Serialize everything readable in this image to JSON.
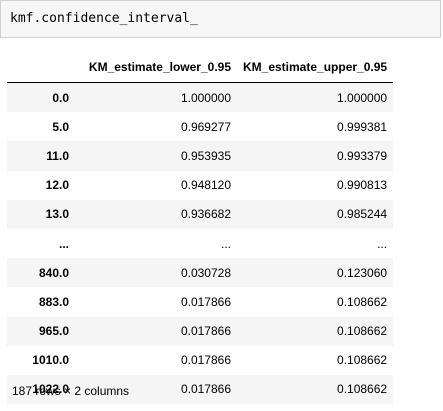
{
  "code_cell": {
    "source": "kmf.confidence_interval_"
  },
  "table": {
    "columns": [
      "",
      "KM_estimate_lower_0.95",
      "KM_estimate_upper_0.95"
    ],
    "rows": [
      {
        "index": "0.0",
        "lower": "1.000000",
        "upper": "1.000000"
      },
      {
        "index": "5.0",
        "lower": "0.969277",
        "upper": "0.999381"
      },
      {
        "index": "11.0",
        "lower": "0.953935",
        "upper": "0.993379"
      },
      {
        "index": "12.0",
        "lower": "0.948120",
        "upper": "0.990813"
      },
      {
        "index": "13.0",
        "lower": "0.936682",
        "upper": "0.985244"
      },
      {
        "index": "...",
        "lower": "...",
        "upper": "..."
      },
      {
        "index": "840.0",
        "lower": "0.030728",
        "upper": "0.123060"
      },
      {
        "index": "883.0",
        "lower": "0.017866",
        "upper": "0.108662"
      },
      {
        "index": "965.0",
        "lower": "0.017866",
        "upper": "0.108662"
      },
      {
        "index": "1010.0",
        "lower": "0.017866",
        "upper": "0.108662"
      },
      {
        "index": "1022.0",
        "lower": "0.017866",
        "upper": "0.108662"
      }
    ]
  },
  "footer": {
    "shape_text": "187 rows × 2 columns"
  }
}
